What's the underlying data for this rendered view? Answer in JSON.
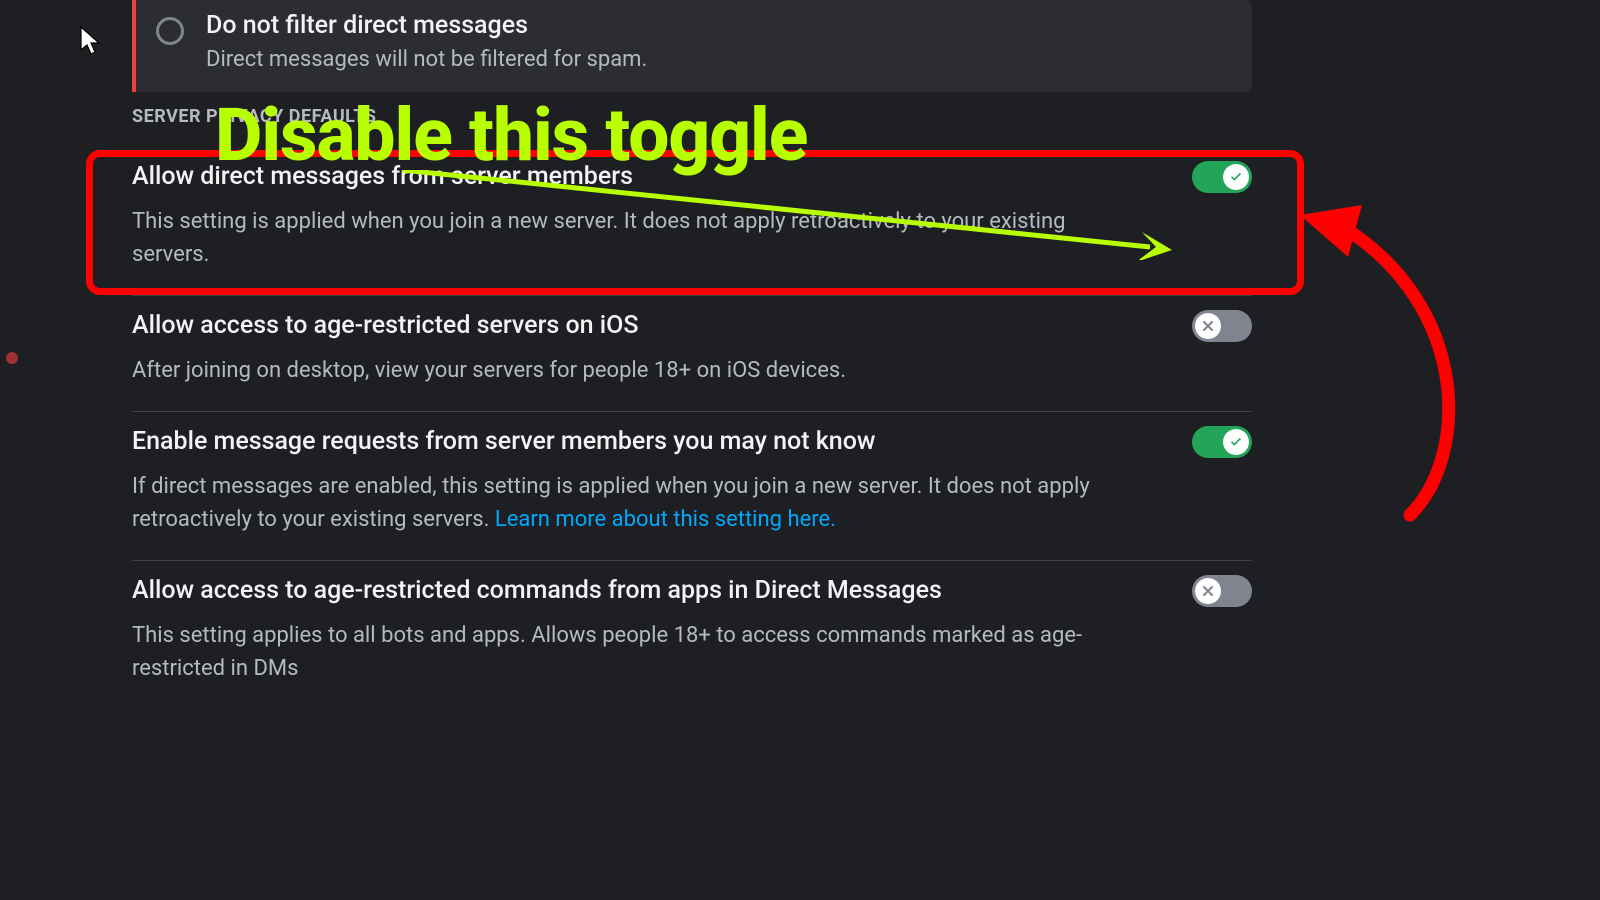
{
  "radio_option": {
    "title": "Do not filter direct messages",
    "description": "Direct messages will not be filtered for spam."
  },
  "section_header": "SERVER PRIVACY DEFAULTS",
  "settings": [
    {
      "title": "Allow direct messages from server members",
      "description": "This setting is applied when you join a new server. It does not apply retroactively to your existing servers.",
      "enabled": true,
      "highlighted": true
    },
    {
      "title": "Allow access to age-restricted servers on iOS",
      "description": "After joining on desktop, view your servers for people 18+ on iOS devices.",
      "enabled": false
    },
    {
      "title": "Enable message requests from server members you may not know",
      "description": "If direct messages are enabled, this setting is applied when you join a new server. It does not apply retroactively to your existing servers. ",
      "link_text": "Learn more about this setting here.",
      "enabled": true
    },
    {
      "title": "Allow access to age-restricted commands from apps in Direct Messages",
      "description": "This setting applies to all bots and apps. Allows people 18+ to access commands marked as age-restricted in DMs",
      "enabled": false
    }
  ],
  "annotation": {
    "text": "Disable this toggle"
  },
  "colors": {
    "accent_green": "#23a559",
    "annotation_green": "#b8ff00",
    "annotation_red": "#ff0000",
    "link_blue": "#00a8fc",
    "danger_red": "#f23f42"
  }
}
